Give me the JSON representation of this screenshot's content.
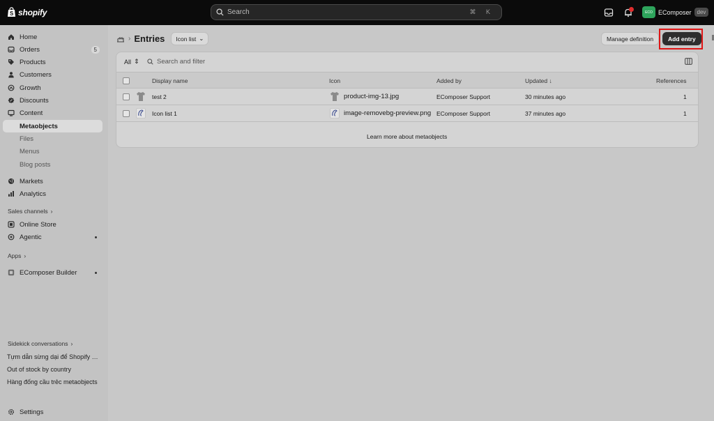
{
  "topbar": {
    "brand": "shopify",
    "search_placeholder": "Search",
    "search_shortcut": "⌘ K",
    "store_avatar": "ECO",
    "store_name": "EComposer",
    "store_tag": "dev"
  },
  "sidebar": {
    "items": [
      {
        "label": "Home",
        "icon": "home-icon"
      },
      {
        "label": "Orders",
        "icon": "orders-icon",
        "count": "5"
      },
      {
        "label": "Products",
        "icon": "tag-icon"
      },
      {
        "label": "Customers",
        "icon": "person-icon"
      },
      {
        "label": "Growth",
        "icon": "growth-icon"
      },
      {
        "label": "Discounts",
        "icon": "discount-icon"
      },
      {
        "label": "Content",
        "icon": "content-icon"
      }
    ],
    "sub_items": [
      "Metaobjects",
      "Files",
      "Menus",
      "Blog posts"
    ],
    "items2": [
      {
        "label": "Markets",
        "icon": "globe-icon"
      },
      {
        "label": "Analytics",
        "icon": "analytics-icon"
      }
    ],
    "sales_channels_label": "Sales channels",
    "channels": [
      "Online Store",
      "Agentic"
    ],
    "apps_label": "Apps",
    "apps": [
      "EComposer Builder"
    ],
    "sidekick_label": "Sidekick conversations",
    "sidekick_items": [
      "Tựm dẫn sừng dại để Shopify Liquid",
      "Out of stock by country",
      "Hàng đống cầu trẻc metaobjects"
    ],
    "settings_label": "Settings"
  },
  "main": {
    "title": "Entries",
    "definition_pill": "Icon list",
    "manage_button": "Manage definition",
    "add_button": "Add entry",
    "filter_all": "All",
    "filter_placeholder": "Search and filter",
    "columns": {
      "display_name": "Display name",
      "icon": "Icon",
      "added_by": "Added by",
      "updated": "Updated ↓",
      "references": "References"
    },
    "rows": [
      {
        "name": "test 2",
        "icon_file": "product-img-13.jpg",
        "added_by": "EComposer Support",
        "updated": "30 minutes ago",
        "references": "1"
      },
      {
        "name": "Icon list 1",
        "icon_file": "image-removebg-preview.png",
        "added_by": "EComposer Support",
        "updated": "37 minutes ago",
        "references": "1"
      }
    ],
    "learn_more": "Learn more about metaobjects"
  },
  "colors": {
    "topbar": "#0b0b0b",
    "primary_button": "#2e2e2e",
    "highlight": "#e01515",
    "store_avatar": "#2ea45c"
  }
}
